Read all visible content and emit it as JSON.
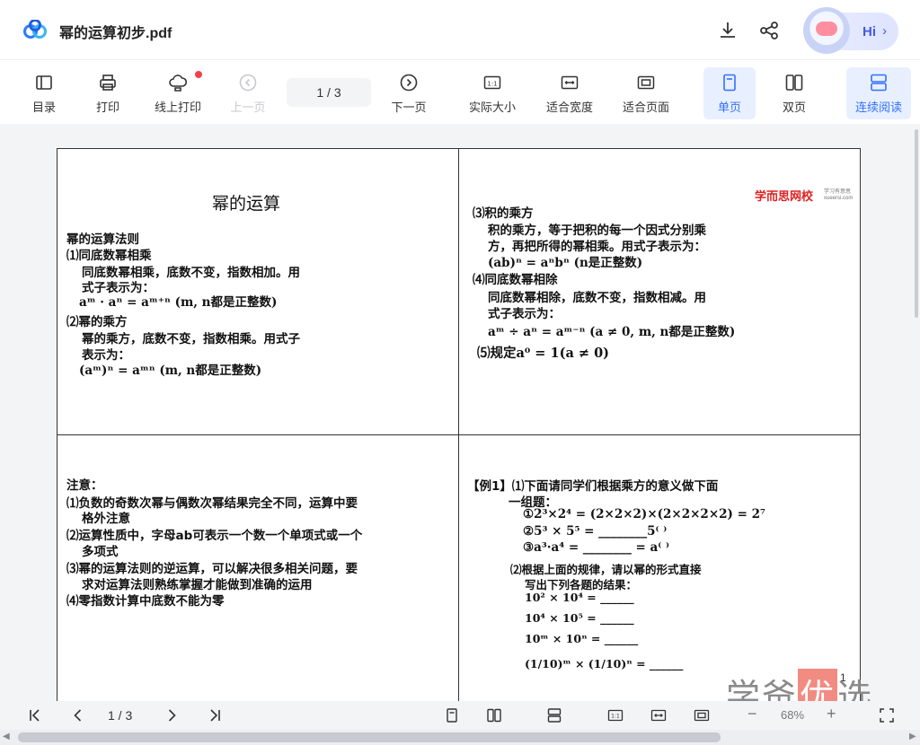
{
  "header": {
    "title": "幂的运算初步.pdf",
    "hi_label": "Hi",
    "hi_chevron": "›"
  },
  "toolbar": {
    "toc": "目录",
    "print": "打印",
    "online_print": "线上打印",
    "prev_page": "上一页",
    "page_indicator": "1  /  3",
    "next_page": "下一页",
    "actual_size": "实际大小",
    "fit_width": "适合宽度",
    "fit_page": "适合页面",
    "single_page": "单页",
    "double_page": "双页",
    "continuous": "连续阅读"
  },
  "document": {
    "title": "幂的运算",
    "brand": "学而思网校",
    "brand_sub": "学习有意思 xueersi.com",
    "q1": [
      "幂的运算法则",
      "⑴同底数幂相乘",
      "同底数幂相乘，底数不变，指数相加。用",
      "式子表示为：",
      "aᵐ · aⁿ = aᵐ⁺ⁿ (m,  n都是正整数)",
      "⑵幂的乘方",
      "幂的乘方，底数不变，指数相乘。用式子",
      "表示为：",
      "(aᵐ)ⁿ = aᵐⁿ (m,  n都是正整数)"
    ],
    "q2": [
      "⑶积的乘方",
      "积的乘方，等于把积的每一个因式分别乘",
      "方，再把所得的幂相乘。用式子表示为：",
      "(ab)ⁿ = aⁿbⁿ (n是正整数)",
      "⑷同底数幂相除",
      "同底数幂相除，底数不变，指数相减。用",
      "式子表示为：",
      "aᵐ ÷ aⁿ = aᵐ⁻ⁿ (a ≠ 0,  m,  n都是正整数)",
      "⑸规定a⁰ = 1(a ≠ 0)"
    ],
    "q3": [
      "注意：",
      "⑴负数的奇数次幂与偶数次幂结果完全不同，运算中要",
      "格外注意",
      "⑵运算性质中，字母ab可表示一个数一个单项式或一个",
      "多项式",
      "⑶幂的运算法则的逆运算，可以解决很多相关问题，要",
      "求对运算法则熟练掌握才能做到准确的运用",
      "⑷零指数计算中底数不能为零"
    ],
    "q4": [
      "【例1】⑴下面请同学们根据乘方的意义做下面",
      "一组题：",
      "①2³×2⁴ = (2×2×2)×(2×2×2×2) = 2⁷",
      "②5³ × 5⁵ = ________5⁽ ⁾",
      "③a³·a⁴ = ________ = a⁽ ⁾",
      "⑵根据上面的规律，请以幂的形式直接",
      "写出下列各题的结果：",
      "10² × 10⁴ = ______",
      "10⁴ × 10⁵ = ______",
      "10ᵐ × 10ⁿ = ______",
      "(1/10)ᵐ × (1/10)ⁿ = ______"
    ]
  },
  "watermark": {
    "text_a": "学爸",
    "text_b": "优",
    "text_c": "选",
    "sup": "1"
  },
  "bottom_bar": {
    "page_indicator": "1 / 3",
    "zoom": "68%",
    "minus": "−",
    "plus": "+"
  }
}
